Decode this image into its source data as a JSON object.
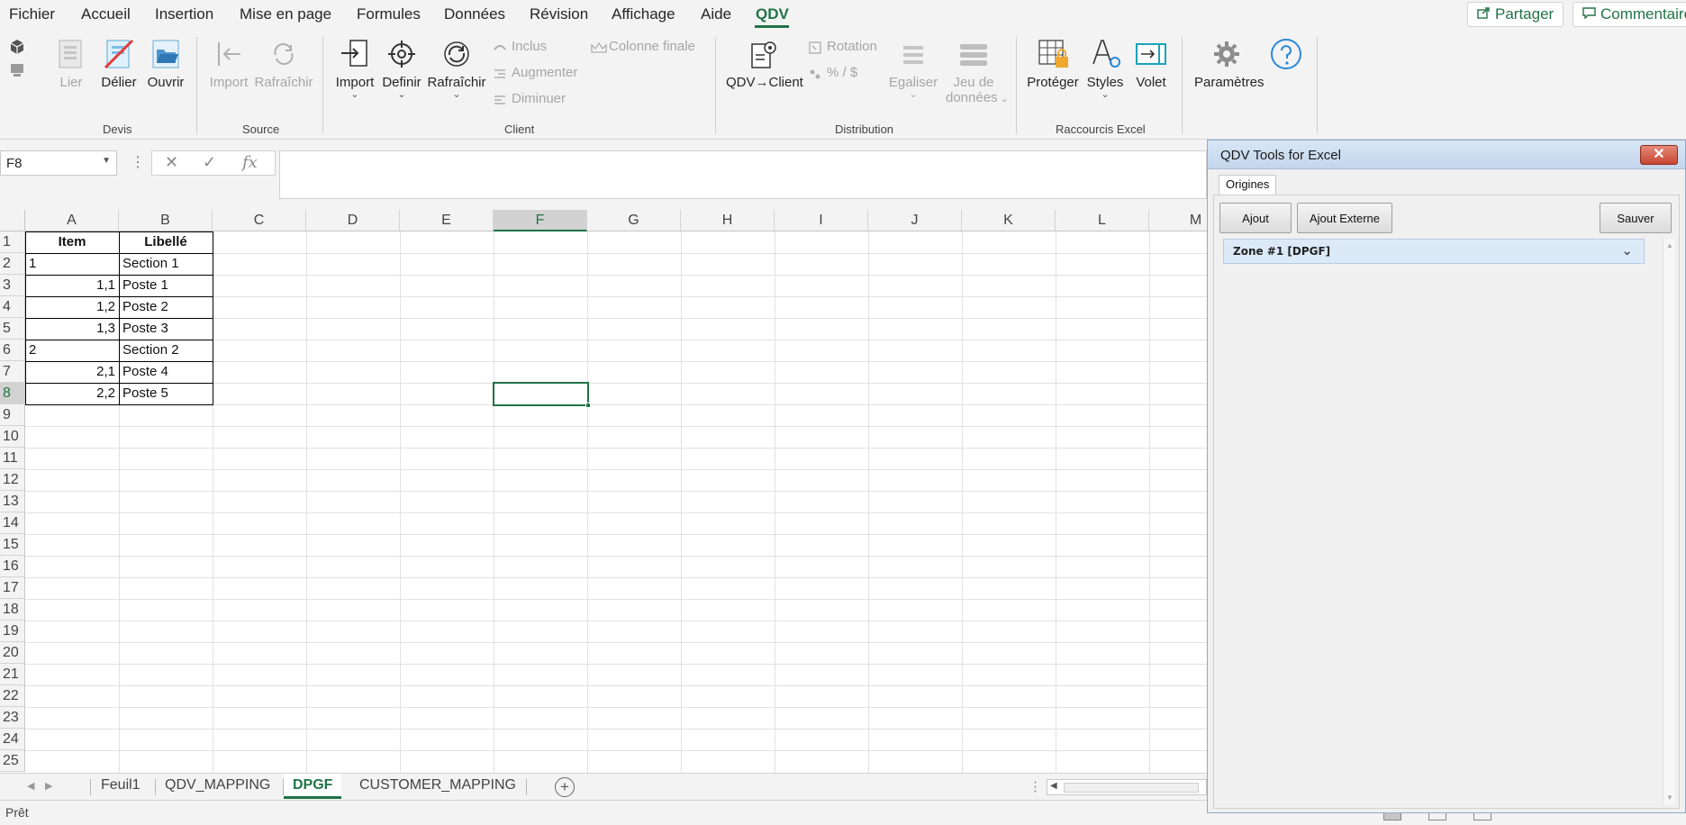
{
  "menu": {
    "items": [
      "Fichier",
      "Accueil",
      "Insertion",
      "Mise en page",
      "Formules",
      "Données",
      "Révision",
      "Affichage",
      "Aide",
      "QDV"
    ],
    "active": "QDV",
    "share_label": "Partager",
    "comments_label": "Commentaires"
  },
  "ribbon": {
    "devis": {
      "label": "Devis",
      "lier": "Lier",
      "delier": "Délier",
      "ouvrir": "Ouvrir"
    },
    "source": {
      "label": "Source",
      "import": "Import",
      "rafraichir": "Rafraîchir"
    },
    "client": {
      "label": "Client",
      "import": "Import",
      "definir": "Definir",
      "rafraichir": "Rafraîchir",
      "inclus": "Inclus",
      "augmenter": "Augmenter",
      "diminuer": "Diminuer",
      "colonne_finale": "Colonne finale"
    },
    "distribution": {
      "label": "Distribution",
      "qdv_client": "QDV→Client",
      "rotation": "Rotation",
      "percent": "% / $",
      "egaliser": "Egaliser",
      "jeu_de": "Jeu de",
      "donnees": "données"
    },
    "raccourcis": {
      "label": "Raccourcis Excel",
      "proteger": "Protéger",
      "styles": "Styles",
      "volet": "Volet"
    },
    "parametres": "Paramètres"
  },
  "formula_bar": {
    "name_box": "F8",
    "formula": ""
  },
  "sheet": {
    "columns": [
      "A",
      "B",
      "C",
      "D",
      "E",
      "F",
      "G",
      "H",
      "I",
      "J",
      "K",
      "L",
      "M"
    ],
    "selected_column": "F",
    "rows": [
      "1",
      "2",
      "3",
      "4",
      "5",
      "6",
      "7",
      "8",
      "9",
      "10",
      "11",
      "12",
      "13",
      "14",
      "15",
      "16",
      "17",
      "18",
      "19",
      "20",
      "21",
      "22",
      "23",
      "24",
      "25"
    ],
    "selected_row": "8",
    "headers": {
      "item": "Item",
      "libelle": "Libellé"
    },
    "data": [
      {
        "item": "1",
        "libelle": "Section 1",
        "align": "left"
      },
      {
        "item": "1,1",
        "libelle": "Poste 1",
        "align": "right"
      },
      {
        "item": "1,2",
        "libelle": "Poste 2",
        "align": "right"
      },
      {
        "item": "1,3",
        "libelle": "Poste 3",
        "align": "right"
      },
      {
        "item": "2",
        "libelle": "Section 2",
        "align": "left"
      },
      {
        "item": "2,1",
        "libelle": "Poste 4",
        "align": "right"
      },
      {
        "item": "2,2",
        "libelle": "Poste 5",
        "align": "right"
      }
    ]
  },
  "tabs": [
    {
      "label": "Feuil1",
      "active": false
    },
    {
      "label": "QDV_MAPPING",
      "active": false
    },
    {
      "label": "DPGF",
      "active": true
    },
    {
      "label": "CUSTOMER_MAPPING",
      "active": false
    }
  ],
  "status": {
    "text": "Prêt"
  },
  "pane": {
    "title": "QDV Tools for Excel",
    "tab": "Origines",
    "btn_ajout": "Ajout",
    "btn_ajout_externe": "Ajout Externe",
    "btn_sauver": "Sauver",
    "zone": "Zone #1 [DPGF]"
  },
  "colors": {
    "accent": "#217346",
    "pane_header": "#d8e6f5",
    "zone_bg": "#dce9f7"
  }
}
